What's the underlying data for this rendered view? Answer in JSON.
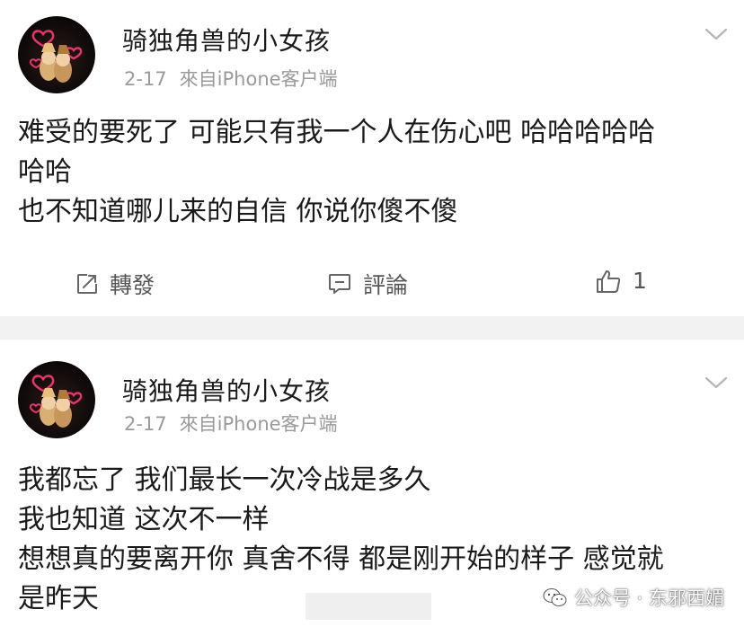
{
  "posts": [
    {
      "username": "骑独角兽的小女孩",
      "date": "2-17",
      "source": "來自iPhone客户端",
      "lines": [
        "难受的要死了 可能只有我一个人在伤心吧 哈哈哈哈哈",
        "哈哈",
        "也不知道哪儿来的自信 你说你傻不傻"
      ],
      "actions": {
        "repost_label": "轉發",
        "comment_label": "評論",
        "like_count": "1"
      }
    },
    {
      "username": "骑独角兽的小女孩",
      "date": "2-17",
      "source": "來自iPhone客户端",
      "lines": [
        "我都忘了 我们最长一次冷战是多久",
        "我也知道 这次不一样",
        "想想真的要离开你 真舍不得 都是刚开始的样子 感觉就",
        "是昨天"
      ]
    }
  ],
  "watermark": "公众号 · 东邪西媚",
  "colors": {
    "text": "#1a1a1a",
    "meta": "#9a9a9a",
    "separator": "#f2f2f2"
  },
  "icons": [
    "avatar-heart-icon",
    "chevron-down-icon",
    "repost-icon",
    "comment-icon",
    "like-icon",
    "wechat-icon"
  ]
}
